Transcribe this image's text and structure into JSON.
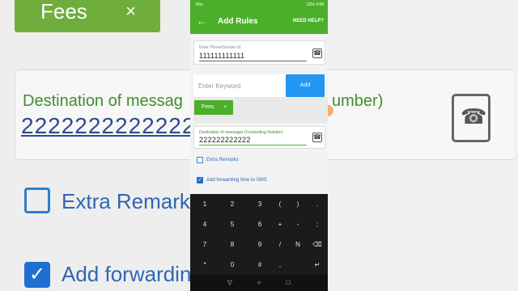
{
  "status_bar": {
    "left": "Vibe",
    "right": "32% 4:58"
  },
  "app_bar": {
    "title": "Add Rules",
    "help_label": "NEED HELP?"
  },
  "sender": {
    "label": "Enter Phone/Sender Id",
    "value": "111111111111"
  },
  "keyword": {
    "placeholder": "Enter Keyword",
    "add_label": "Add"
  },
  "chips": [
    {
      "label": "Fees",
      "remove": "×"
    }
  ],
  "destination": {
    "label": "Destination of messages (Forwarding Number)",
    "value": "222222222222"
  },
  "options": [
    {
      "label": "Extra Remarks",
      "checked": false
    },
    {
      "label": "Add forwarding time to SMS",
      "checked": true
    }
  ],
  "keyboard": {
    "rows": [
      [
        "1",
        "2",
        "3",
        "(",
        ")",
        "."
      ],
      [
        "4",
        "5",
        "6",
        "+",
        "-",
        ";"
      ],
      [
        "7",
        "8",
        "9",
        "/",
        "N",
        "⌫"
      ],
      [
        "*",
        "0",
        "#",
        ",",
        "",
        "↵"
      ]
    ]
  },
  "nav": {
    "back": "▽",
    "home": "○",
    "recents": "□"
  },
  "background": {
    "chip_label": "Fees",
    "chip_remove": "×",
    "dest_label": "Destination of messag",
    "dest_label_tail": "umber)",
    "dest_value": "2222222222222",
    "extra_remarks": "Extra Remarks",
    "add_forwarding": "Add forwarding"
  },
  "colors": {
    "green": "#4caf2a",
    "blue_button": "#2196f3",
    "checkbox_blue": "#1f6fd0"
  }
}
